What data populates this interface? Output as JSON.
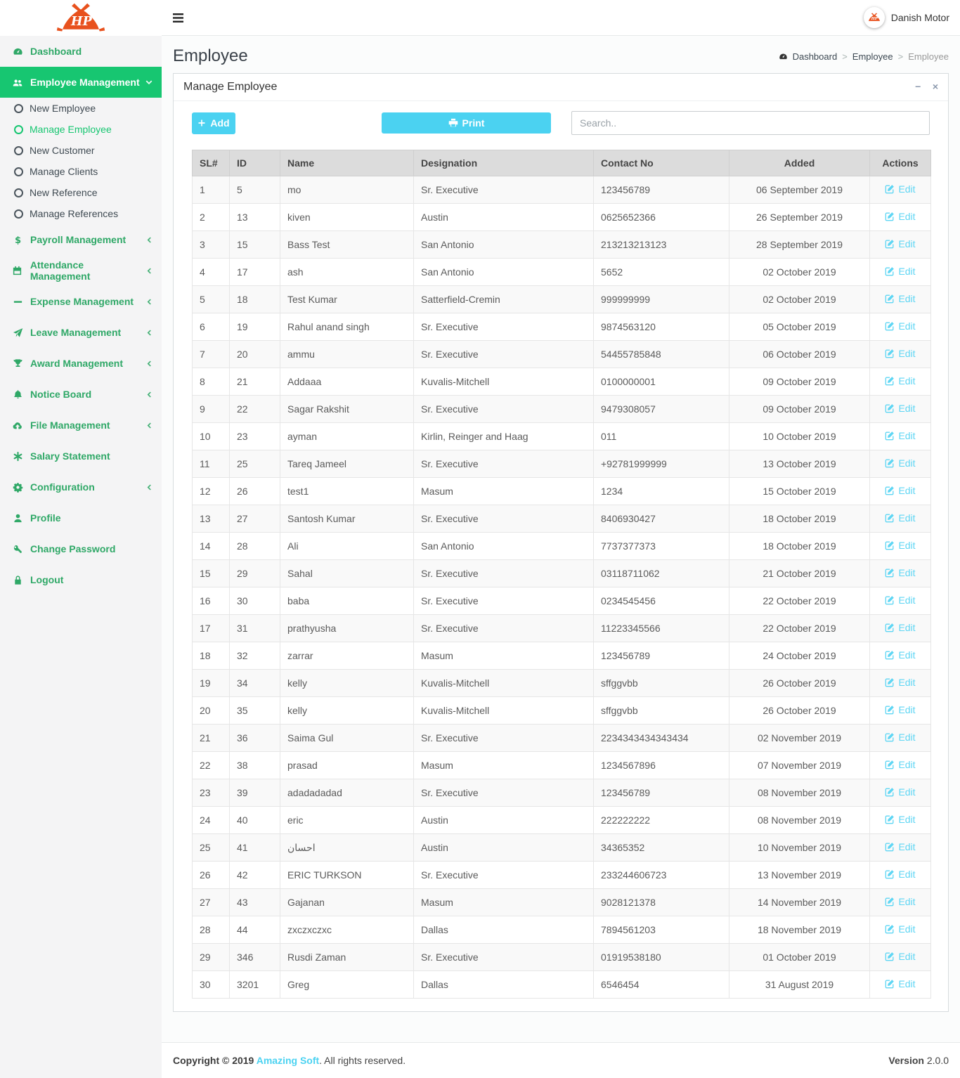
{
  "colors": {
    "brand_green": "#17c671",
    "menu_text_green": "#2fa867",
    "accent_cyan": "#4bd2f1",
    "edit_link_cyan": "#5fd6f4",
    "logo_orange": "#e8511d",
    "table_header_bg": "#dcdcdc"
  },
  "topbar": {
    "user": "Danish Motor"
  },
  "header": {
    "title": "Employee",
    "separator": ">",
    "breadcrumb": [
      "Dashboard",
      "Employee",
      "Employee"
    ]
  },
  "sidebar": {
    "items": [
      {
        "icon": "dashboard-icon",
        "label": "Dashboard"
      },
      {
        "icon": "users-icon",
        "label": "Employee Management",
        "chevron": "down",
        "active": true,
        "children": [
          {
            "label": "New Employee"
          },
          {
            "label": "Manage Employee",
            "active": true
          },
          {
            "label": "New Customer"
          },
          {
            "label": "Manage Clients"
          },
          {
            "label": "New Reference"
          },
          {
            "label": "Manage References"
          }
        ]
      },
      {
        "icon": "dollar-icon",
        "label": "Payroll Management",
        "chevron": "left"
      },
      {
        "icon": "calendar-icon",
        "label": "Attendance Management",
        "chevron": "left"
      },
      {
        "icon": "minus-icon",
        "label": "Expense Management",
        "chevron": "left"
      },
      {
        "icon": "send-icon",
        "label": "Leave Management",
        "chevron": "left"
      },
      {
        "icon": "trophy-icon",
        "label": "Award Management",
        "chevron": "left"
      },
      {
        "icon": "bell-icon",
        "label": "Notice Board",
        "chevron": "left"
      },
      {
        "icon": "cloud-upload-icon",
        "label": "File Management",
        "chevron": "left"
      },
      {
        "icon": "asterisk-icon",
        "label": "Salary Statement"
      },
      {
        "icon": "gear-icon",
        "label": "Configuration",
        "chevron": "left"
      },
      {
        "icon": "user-icon",
        "label": "Profile"
      },
      {
        "icon": "key-icon",
        "label": "Change Password"
      },
      {
        "icon": "lock-icon",
        "label": "Logout"
      }
    ]
  },
  "panel": {
    "title": "Manage Employee",
    "collapse_glyph": "−",
    "close_glyph": "×",
    "add_label": "Add",
    "print_label": "Print",
    "search_placeholder": "Search..",
    "search_value": ""
  },
  "table": {
    "headers": [
      "SL#",
      "ID",
      "Name",
      "Designation",
      "Contact No",
      "Added",
      "Actions"
    ],
    "edit_label": "Edit",
    "rows": [
      [
        "1",
        "5",
        "mo",
        "Sr. Executive",
        "123456789",
        "06 September 2019"
      ],
      [
        "2",
        "13",
        "kiven",
        "Austin",
        "0625652366",
        "26 September 2019"
      ],
      [
        "3",
        "15",
        "Bass Test",
        "San Antonio",
        "213213213123",
        "28 September 2019"
      ],
      [
        "4",
        "17",
        "ash",
        "San Antonio",
        "5652",
        "02 October 2019"
      ],
      [
        "5",
        "18",
        "Test Kumar",
        "Satterfield-Cremin",
        "999999999",
        "02 October 2019"
      ],
      [
        "6",
        "19",
        "Rahul anand singh",
        "Sr. Executive",
        "9874563120",
        "05 October 2019"
      ],
      [
        "7",
        "20",
        "ammu",
        "Sr. Executive",
        "54455785848",
        "06 October 2019"
      ],
      [
        "8",
        "21",
        "Addaaa",
        "Kuvalis-Mitchell",
        "0100000001",
        "09 October 2019"
      ],
      [
        "9",
        "22",
        "Sagar Rakshit",
        "Sr. Executive",
        "9479308057",
        "09 October 2019"
      ],
      [
        "10",
        "23",
        "ayman",
        "Kirlin, Reinger and Haag",
        "011",
        "10 October 2019"
      ],
      [
        "11",
        "25",
        "Tareq Jameel",
        "Sr. Executive",
        "+92781999999",
        "13 October 2019"
      ],
      [
        "12",
        "26",
        "test1",
        "Masum",
        "1234",
        "15 October 2019"
      ],
      [
        "13",
        "27",
        "Santosh Kumar",
        "Sr. Executive",
        "8406930427",
        "18 October 2019"
      ],
      [
        "14",
        "28",
        "Ali",
        "San Antonio",
        "7737377373",
        "18 October 2019"
      ],
      [
        "15",
        "29",
        "Sahal",
        "Sr. Executive",
        "03118711062",
        "21 October 2019"
      ],
      [
        "16",
        "30",
        "baba",
        "Sr. Executive",
        "0234545456",
        "22 October 2019"
      ],
      [
        "17",
        "31",
        "prathyusha",
        "Sr. Executive",
        "11223345566",
        "22 October 2019"
      ],
      [
        "18",
        "32",
        "zarrar",
        "Masum",
        "123456789",
        "24 October 2019"
      ],
      [
        "19",
        "34",
        "kelly",
        "Kuvalis-Mitchell",
        "sffggvbb",
        "26 October 2019"
      ],
      [
        "20",
        "35",
        "kelly",
        "Kuvalis-Mitchell",
        "sffggvbb",
        "26 October 2019"
      ],
      [
        "21",
        "36",
        "Saima Gul",
        "Sr. Executive",
        "2234343434343434",
        "02 November 2019"
      ],
      [
        "22",
        "38",
        "prasad",
        "Masum",
        "1234567896",
        "07 November 2019"
      ],
      [
        "23",
        "39",
        "adadadadad",
        "Sr. Executive",
        "123456789",
        "08 November 2019"
      ],
      [
        "24",
        "40",
        "eric",
        "Austin",
        "222222222",
        "08 November 2019"
      ],
      [
        "25",
        "41",
        "احسان",
        "Austin",
        "34365352",
        "10 November 2019"
      ],
      [
        "26",
        "42",
        "ERIC TURKSON",
        "Sr. Executive",
        "233244606723",
        "13 November 2019"
      ],
      [
        "27",
        "43",
        "Gajanan",
        "Masum",
        "9028121378",
        "14 November 2019"
      ],
      [
        "28",
        "44",
        "zxczxczxc",
        "Dallas",
        "7894561203",
        "18 November 2019"
      ],
      [
        "29",
        "346",
        "Rusdi Zaman",
        "Sr. Executive",
        "01919538180",
        "01 October 2019"
      ],
      [
        "30",
        "3201",
        "Greg",
        "Dallas",
        "6546454",
        "31 August 2019"
      ]
    ]
  },
  "footer": {
    "copyright_prefix": "Copyright © 2019 ",
    "company": "Amazing Soft",
    "copyright_suffix": ". All rights reserved.",
    "version_label": "Version",
    "version": "2.0.0"
  }
}
